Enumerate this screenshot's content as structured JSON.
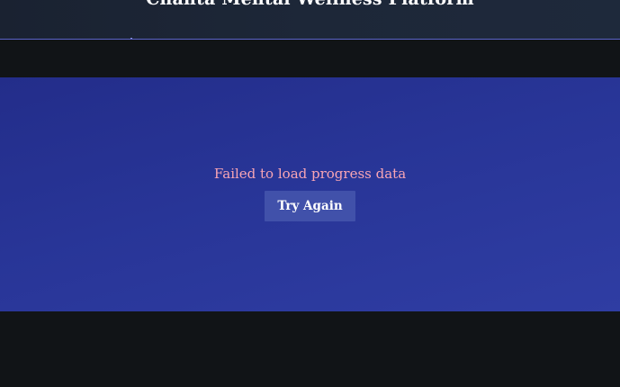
{
  "header": {
    "title": "Chahta Mental Wellness Platform"
  },
  "error": {
    "message": "Failed to load progress data",
    "retry_label": "Try Again"
  },
  "colors": {
    "background": "#111417",
    "header": "#1e293b",
    "panel": "#283597",
    "error_text": "#f8a5b4",
    "button": "#4151aa"
  }
}
